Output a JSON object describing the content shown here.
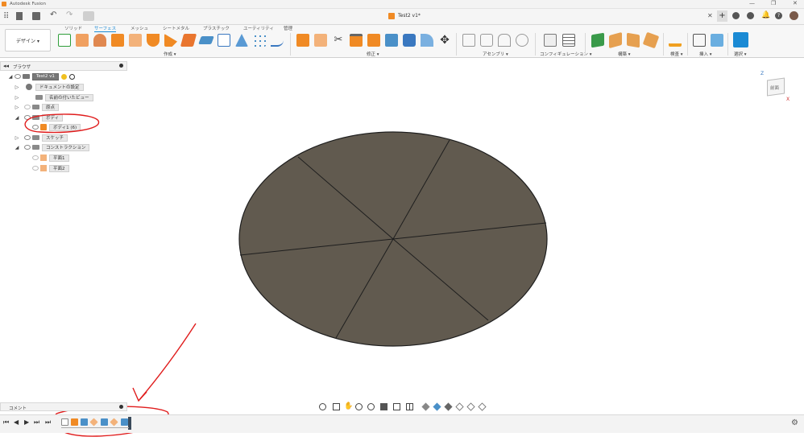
{
  "window": {
    "title": "Autodesk Fusion",
    "document_tab": "Test2 v1*"
  },
  "workspace": {
    "label": "デザイン ▾"
  },
  "ribbon": {
    "tabs": [
      "ソリッド",
      "サーフェス",
      "メッシュ",
      "シートメタル",
      "プラスチック",
      "ユーティリティ",
      "管理"
    ],
    "active_tab_index": 1,
    "groups": [
      "作成 ▾",
      "修正 ▾",
      "アセンブリ ▾",
      "コンフィギュレーション ▾",
      "構築 ▾",
      "検査 ▾",
      "挿入 ▾",
      "選択 ▾"
    ]
  },
  "browser": {
    "title": "ブラウザ",
    "root": "Test2 v1",
    "items": [
      {
        "label": "ドキュメントの設定",
        "icon": "gear-icon"
      },
      {
        "label": "名前の付いたビュー",
        "icon": "folder-icon"
      },
      {
        "label": "原点",
        "icon": "folder-icon"
      },
      {
        "label": "ボディ",
        "icon": "folder-icon"
      },
      {
        "label": "ボディ1 (6)",
        "icon": "body-icon"
      },
      {
        "label": "スケッチ",
        "icon": "folder-icon"
      },
      {
        "label": "コンストラクション",
        "icon": "folder-icon"
      },
      {
        "label": "平面1",
        "icon": "plane-icon"
      },
      {
        "label": "平面2",
        "icon": "plane-icon"
      }
    ]
  },
  "comment": {
    "label": "コメント"
  },
  "viewcube": {
    "face_label": "前面",
    "axis_z": "Z",
    "axis_x": "X"
  },
  "colors": {
    "accent": "#1a8ad4",
    "body_fill": "#615a4f",
    "annotation": "#e01c1c"
  }
}
